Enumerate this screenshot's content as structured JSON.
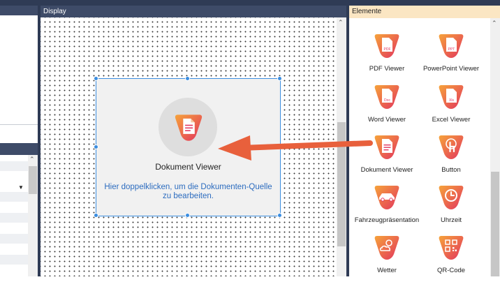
{
  "display_panel": {
    "title": "Display"
  },
  "elements_panel": {
    "title": "Elemente",
    "items": [
      {
        "label": "PDF Viewer",
        "icon": "pdf-document-icon",
        "badge": "PDF"
      },
      {
        "label": "PowerPoint Viewer",
        "icon": "ppt-document-icon",
        "badge": "PPT"
      },
      {
        "label": "Word Viewer",
        "icon": "doc-document-icon",
        "badge": "Doc"
      },
      {
        "label": "Excel Viewer",
        "icon": "xls-document-icon",
        "badge": "Xls"
      },
      {
        "label": "Dokument Viewer",
        "icon": "document-icon",
        "badge": ""
      },
      {
        "label": "Button",
        "icon": "touch-button-icon",
        "badge": ""
      },
      {
        "label": "Fahrzeugpräsentation",
        "icon": "car-icon",
        "badge": ""
      },
      {
        "label": "Uhrzeit",
        "icon": "clock-icon",
        "badge": ""
      },
      {
        "label": "Wetter",
        "icon": "weather-icon",
        "badge": ""
      },
      {
        "label": "QR-Code",
        "icon": "qr-code-icon",
        "badge": ""
      }
    ]
  },
  "widget": {
    "title": "Dokument Viewer",
    "hint_line1": "Hier doppelklicken, um die Dokumenten-Quelle",
    "hint_line2": "zu bearbeiten.",
    "icon": "document-icon"
  },
  "colors": {
    "frame": "#2f3b55",
    "panel_header": "#3e4b68",
    "elements_header": "#fbe6c3",
    "accent_gradient_start": "#f6a33a",
    "accent_gradient_end": "#e2345e",
    "arrow": "#e8603c",
    "selection": "#3a8de0",
    "hint_text": "#2c6cbf"
  },
  "left_panel": {
    "dropdown_icon": "triangle-down-icon"
  }
}
